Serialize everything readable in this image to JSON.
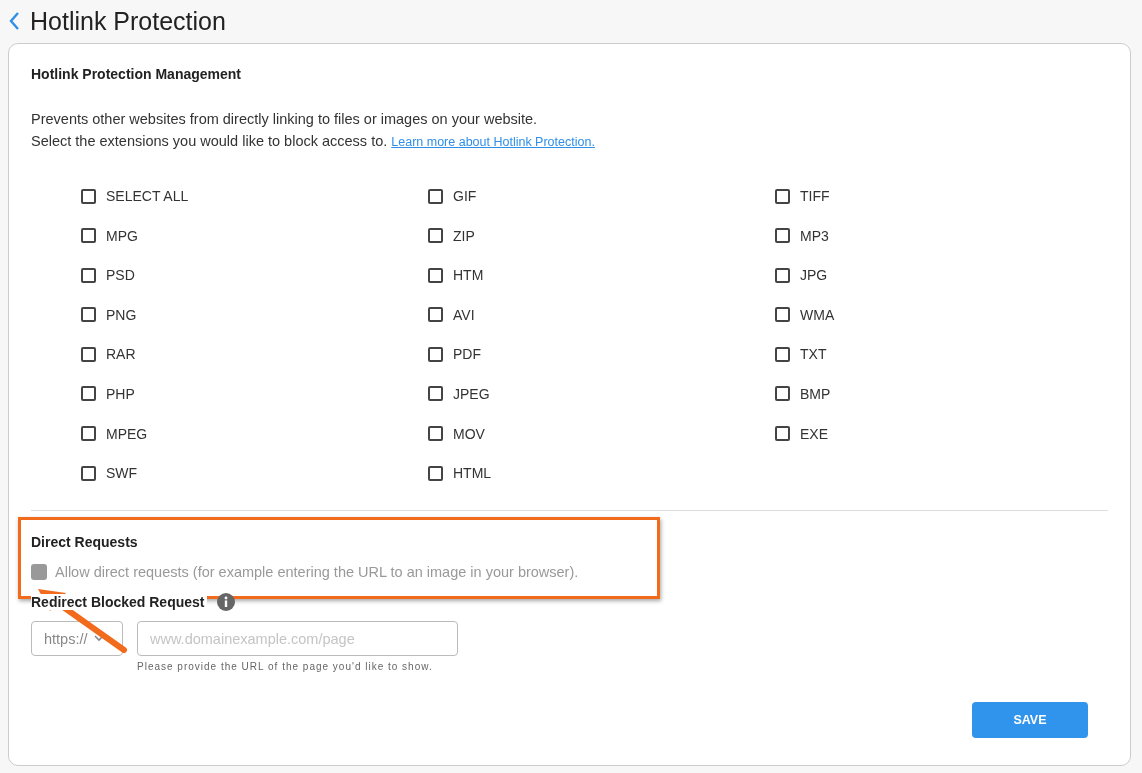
{
  "page": {
    "title": "Hotlink Protection"
  },
  "management": {
    "heading": "Hotlink Protection Management",
    "description": "Prevents other websites from directly linking to files or images on your website.",
    "instruction": "Select the extensions you would like to block access to.",
    "link": "Learn more about Hotlink Protection."
  },
  "extensions": [
    {
      "label": "SELECT ALL",
      "checked": false
    },
    {
      "label": "GIF",
      "checked": false
    },
    {
      "label": "TIFF",
      "checked": false
    },
    {
      "label": "MPG",
      "checked": false
    },
    {
      "label": "ZIP",
      "checked": false
    },
    {
      "label": "MP3",
      "checked": false
    },
    {
      "label": "PSD",
      "checked": false
    },
    {
      "label": "HTM",
      "checked": false
    },
    {
      "label": "JPG",
      "checked": false
    },
    {
      "label": "PNG",
      "checked": false
    },
    {
      "label": "AVI",
      "checked": false
    },
    {
      "label": "WMA",
      "checked": false
    },
    {
      "label": "RAR",
      "checked": false
    },
    {
      "label": "PDF",
      "checked": false
    },
    {
      "label": "TXT",
      "checked": false
    },
    {
      "label": "PHP",
      "checked": false
    },
    {
      "label": "JPEG",
      "checked": false
    },
    {
      "label": "BMP",
      "checked": false
    },
    {
      "label": "MPEG",
      "checked": false
    },
    {
      "label": "MOV",
      "checked": false
    },
    {
      "label": "EXE",
      "checked": false
    },
    {
      "label": "SWF",
      "checked": false
    },
    {
      "label": "HTML",
      "checked": false
    }
  ],
  "direct_requests": {
    "heading": "Direct Requests",
    "label": "Allow direct requests (for example entering the URL to an image in your browser).",
    "checked": false,
    "disabled": true
  },
  "redirect": {
    "heading": "Redirect Blocked Request",
    "protocol": "https://",
    "placeholder": "www.domainexample.com/page",
    "hint": "Please provide the URL of the page you'd like to show."
  },
  "save_button": "SAVE"
}
